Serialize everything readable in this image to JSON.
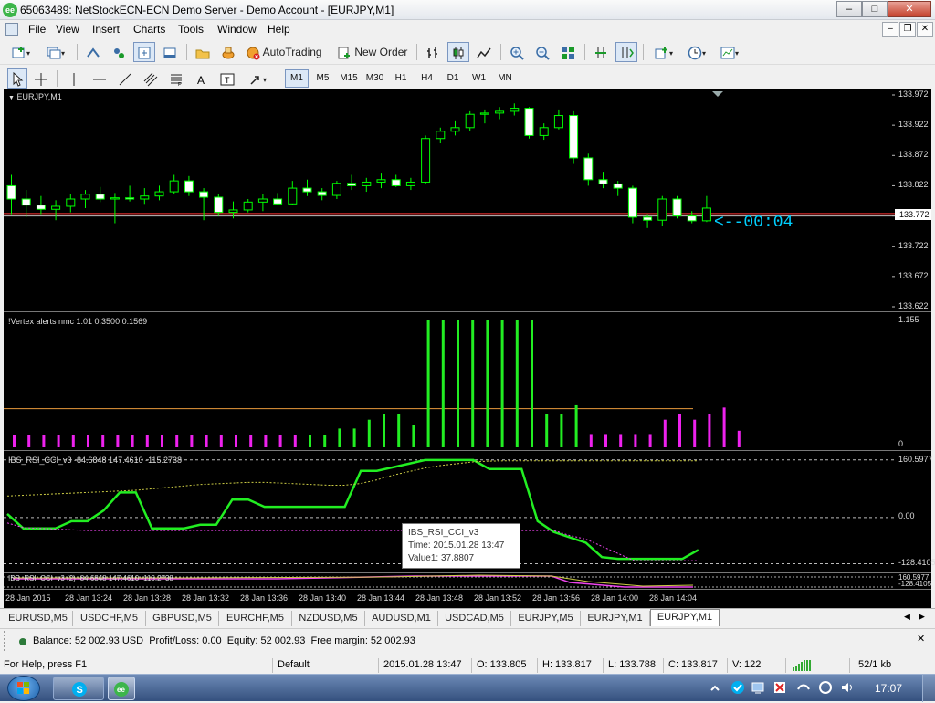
{
  "window": {
    "title": "65063489: NetStockECN-ECN Demo Server - Demo Account - [EURJPY,M1]",
    "app_icon_text": "ee",
    "minimize": "–",
    "maximize": "□",
    "close": "✕"
  },
  "menu": {
    "items": [
      "File",
      "View",
      "Insert",
      "Charts",
      "Tools",
      "Window",
      "Help"
    ],
    "mdi_min": "–",
    "mdi_restore": "❐",
    "mdi_close": "✕"
  },
  "toolbar": {
    "autotrading_label": "AutoTrading",
    "new_order_label": "New Order"
  },
  "search": {
    "placeholder": "",
    "icon": "search-icon"
  },
  "timeframes": [
    "M1",
    "M5",
    "M15",
    "M30",
    "H1",
    "H4",
    "D1",
    "W1",
    "MN"
  ],
  "timeframe_selected": "M1",
  "main_chart": {
    "label": "EURJPY,M1",
    "price_scale": [
      "133.972",
      "133.922",
      "133.872",
      "133.822",
      "133.772",
      "133.722",
      "133.672",
      "133.622"
    ],
    "current_price": "133.772",
    "countdown": "<--00:04",
    "colors": {
      "bull": "#00ff00",
      "bear_fill": "#ffffff",
      "wick": "#00ff00",
      "bid_line": "#ff3333",
      "countdown": "#00d0ff"
    }
  },
  "chart_data": [
    {
      "type": "candlestick",
      "title": "EURJPY,M1",
      "ylim": [
        133.622,
        133.972
      ],
      "bars": [
        {
          "o": 133.822,
          "h": 133.84,
          "l": 133.775,
          "c": 133.8
        },
        {
          "o": 133.8,
          "h": 133.815,
          "l": 133.77,
          "c": 133.79
        },
        {
          "o": 133.79,
          "h": 133.805,
          "l": 133.775,
          "c": 133.783
        },
        {
          "o": 133.783,
          "h": 133.798,
          "l": 133.765,
          "c": 133.788
        },
        {
          "o": 133.788,
          "h": 133.808,
          "l": 133.778,
          "c": 133.8
        },
        {
          "o": 133.8,
          "h": 133.815,
          "l": 133.785,
          "c": 133.808
        },
        {
          "o": 133.808,
          "h": 133.82,
          "l": 133.795,
          "c": 133.8
        },
        {
          "o": 133.8,
          "h": 133.81,
          "l": 133.76,
          "c": 133.802
        },
        {
          "o": 133.802,
          "h": 133.822,
          "l": 133.796,
          "c": 133.8
        },
        {
          "o": 133.8,
          "h": 133.818,
          "l": 133.792,
          "c": 133.805
        },
        {
          "o": 133.805,
          "h": 133.822,
          "l": 133.798,
          "c": 133.812
        },
        {
          "o": 133.812,
          "h": 133.84,
          "l": 133.808,
          "c": 133.83
        },
        {
          "o": 133.83,
          "h": 133.838,
          "l": 133.805,
          "c": 133.812
        },
        {
          "o": 133.812,
          "h": 133.818,
          "l": 133.765,
          "c": 133.803
        },
        {
          "o": 133.803,
          "h": 133.808,
          "l": 133.772,
          "c": 133.778
        },
        {
          "o": 133.778,
          "h": 133.796,
          "l": 133.768,
          "c": 133.782
        },
        {
          "o": 133.782,
          "h": 133.8,
          "l": 133.778,
          "c": 133.795
        },
        {
          "o": 133.795,
          "h": 133.808,
          "l": 133.78,
          "c": 133.8
        },
        {
          "o": 133.8,
          "h": 133.81,
          "l": 133.79,
          "c": 133.792
        },
        {
          "o": 133.792,
          "h": 133.83,
          "l": 133.79,
          "c": 133.818
        },
        {
          "o": 133.818,
          "h": 133.832,
          "l": 133.805,
          "c": 133.812
        },
        {
          "o": 133.812,
          "h": 133.818,
          "l": 133.798,
          "c": 133.806
        },
        {
          "o": 133.806,
          "h": 133.83,
          "l": 133.8,
          "c": 133.826
        },
        {
          "o": 133.826,
          "h": 133.84,
          "l": 133.815,
          "c": 133.822
        },
        {
          "o": 133.822,
          "h": 133.835,
          "l": 133.812,
          "c": 133.828
        },
        {
          "o": 133.828,
          "h": 133.842,
          "l": 133.818,
          "c": 133.832
        },
        {
          "o": 133.832,
          "h": 133.84,
          "l": 133.82,
          "c": 133.822
        },
        {
          "o": 133.822,
          "h": 133.835,
          "l": 133.815,
          "c": 133.828
        },
        {
          "o": 133.828,
          "h": 133.905,
          "l": 133.825,
          "c": 133.9
        },
        {
          "o": 133.9,
          "h": 133.918,
          "l": 133.892,
          "c": 133.912
        },
        {
          "o": 133.912,
          "h": 133.93,
          "l": 133.905,
          "c": 133.918
        },
        {
          "o": 133.918,
          "h": 133.945,
          "l": 133.912,
          "c": 133.94
        },
        {
          "o": 133.94,
          "h": 133.948,
          "l": 133.925,
          "c": 133.942
        },
        {
          "o": 133.942,
          "h": 133.952,
          "l": 133.932,
          "c": 133.945
        },
        {
          "o": 133.945,
          "h": 133.958,
          "l": 133.938,
          "c": 133.95
        },
        {
          "o": 133.95,
          "h": 133.952,
          "l": 133.9,
          "c": 133.905
        },
        {
          "o": 133.905,
          "h": 133.925,
          "l": 133.898,
          "c": 133.918
        },
        {
          "o": 133.918,
          "h": 133.948,
          "l": 133.915,
          "c": 133.938
        },
        {
          "o": 133.938,
          "h": 133.945,
          "l": 133.858,
          "c": 133.868
        },
        {
          "o": 133.868,
          "h": 133.875,
          "l": 133.822,
          "c": 133.832
        },
        {
          "o": 133.832,
          "h": 133.845,
          "l": 133.818,
          "c": 133.825
        },
        {
          "o": 133.825,
          "h": 133.83,
          "l": 133.805,
          "c": 133.818
        },
        {
          "o": 133.818,
          "h": 133.822,
          "l": 133.76,
          "c": 133.77
        },
        {
          "o": 133.77,
          "h": 133.775,
          "l": 133.752,
          "c": 133.765
        },
        {
          "o": 133.765,
          "h": 133.805,
          "l": 133.755,
          "c": 133.8
        },
        {
          "o": 133.8,
          "h": 133.805,
          "l": 133.768,
          "c": 133.772
        },
        {
          "o": 133.772,
          "h": 133.78,
          "l": 133.76,
          "c": 133.764
        },
        {
          "o": 133.764,
          "h": 133.805,
          "l": 133.762,
          "c": 133.785
        }
      ]
    },
    {
      "type": "bar",
      "title": "!Vertex alerts nmc 1.01 0.3500 0.1569",
      "ylim": [
        0,
        1.155
      ],
      "level": 0.35,
      "scale_labels": [
        "1.155",
        "0"
      ],
      "values": [
        0.11,
        0.11,
        0.11,
        0.11,
        0.11,
        0.11,
        0.11,
        0.11,
        0.11,
        0.11,
        0.11,
        0.11,
        0.11,
        0.11,
        0.11,
        0.11,
        0.11,
        0.11,
        0.11,
        0.11,
        0.11,
        0.11,
        0.17,
        0.17,
        0.25,
        0.3,
        0.3,
        0.2,
        1.155,
        1.155,
        1.155,
        1.155,
        1.155,
        1.155,
        1.155,
        1.155,
        0.3,
        0.3,
        0.38,
        0.12,
        0.12,
        0.12,
        0.12,
        0.12,
        0.25,
        0.3,
        0.25,
        0.3,
        0.36,
        0.15
      ],
      "colors": [
        "m",
        "m",
        "m",
        "m",
        "m",
        "m",
        "m",
        "m",
        "m",
        "m",
        "m",
        "m",
        "m",
        "m",
        "m",
        "m",
        "m",
        "m",
        "m",
        "m",
        "g",
        "g",
        "g",
        "g",
        "g",
        "g",
        "g",
        "g",
        "g",
        "g",
        "g",
        "g",
        "g",
        "g",
        "g",
        "g",
        "g",
        "g",
        "g",
        "m",
        "m",
        "m",
        "m",
        "m",
        "m",
        "m",
        "m",
        "m",
        "m",
        "m"
      ],
      "series_colors": {
        "g": "#22ee22",
        "m": "#ee22ee",
        "level": "#e89a3c"
      }
    },
    {
      "type": "line",
      "title": "IBS_RSI_CCI_v3 -84.6848 147.4610 -115.2738",
      "ylim": [
        -140,
        170
      ],
      "scale_labels": [
        "160.5977",
        "0.00",
        "-128.4105"
      ],
      "levels": [
        160.5977,
        0,
        -128.4105
      ],
      "series": [
        {
          "name": "Value1",
          "color": "#22ee22",
          "values": [
            10,
            -30,
            -30,
            -30,
            -10,
            -10,
            20,
            70,
            70,
            -30,
            -30,
            -30,
            -20,
            -20,
            50,
            50,
            30,
            30,
            30,
            30,
            30,
            30,
            130,
            130,
            140,
            150,
            160,
            160,
            160,
            160,
            135,
            135,
            135,
            -10,
            -40,
            -55,
            -70,
            -110,
            -115,
            -115,
            -115,
            -115,
            -115,
            -90
          ]
        },
        {
          "name": "",
          "color": "#cccc44",
          "dashed": true,
          "values": [
            60,
            62,
            64,
            66,
            68,
            70,
            72,
            74,
            76,
            80,
            84,
            88,
            92,
            94,
            96,
            98,
            98,
            96,
            94,
            92,
            90,
            90,
            95,
            105,
            118,
            128,
            138,
            145,
            150,
            155,
            157,
            158,
            158,
            158,
            158,
            158,
            158,
            158,
            158,
            158,
            158,
            158,
            158,
            158
          ]
        },
        {
          "name": "",
          "color": "#ee44ee",
          "dashed": true,
          "values": [
            -15,
            -28,
            -30,
            -32,
            -34,
            -36,
            -36,
            -36,
            -36,
            -36,
            -36,
            -36,
            -36,
            -36,
            -36,
            -36,
            -36,
            -36,
            -36,
            -36,
            -36,
            -36,
            -36,
            -36,
            -36,
            -36,
            -36,
            -36,
            -36,
            -36,
            -36,
            -36,
            -36,
            -36,
            -36,
            -50,
            -60,
            -80,
            -100,
            -120,
            -120,
            -120,
            -120,
            -120
          ]
        }
      ]
    }
  ],
  "tooltip": {
    "line1": "IBS_RSI_CCI_v3",
    "line2": "Time: 2015.01.28 13:47",
    "line3": "Value1: 37.8807"
  },
  "mini_pane": {
    "label": "IBS_RSI_CCI_v3 (2) -84.6848 147.4610 -115.2738",
    "scale_labels": [
      "160.5977",
      "-128.4105"
    ]
  },
  "time_axis": [
    "28 Jan 2015",
    "28 Jan 13:24",
    "28 Jan 13:28",
    "28 Jan 13:32",
    "28 Jan 13:36",
    "28 Jan 13:40",
    "28 Jan 13:44",
    "28 Jan 13:48",
    "28 Jan 13:52",
    "28 Jan 13:56",
    "28 Jan 14:00",
    "28 Jan 14:04"
  ],
  "chart_tabs": [
    "EURUSD,M5",
    "USDCHF,M5",
    "GBPUSD,M5",
    "EURCHF,M5",
    "NZDUSD,M5",
    "AUDUSD,M1",
    "USDCAD,M5",
    "EURJPY,M5",
    "EURJPY,M1",
    "EURJPY,M1"
  ],
  "chart_tab_active": 9,
  "terminal": {
    "balance_line": "Balance: 52 002.93 USD  Profit/Loss: 0.00  Equity: 52 002.93  Free margin: 52 002.93",
    "close": "✕"
  },
  "status": {
    "help": "For Help, press F1",
    "profile": "Default",
    "datetime": "2015.01.28 13:47",
    "open": "O: 133.805",
    "high": "H: 133.817",
    "low": "L: 133.788",
    "close": "C: 133.817",
    "volume": "V: 122",
    "traffic": "52/1 kb"
  },
  "taskbar": {
    "clock": "17:07"
  }
}
